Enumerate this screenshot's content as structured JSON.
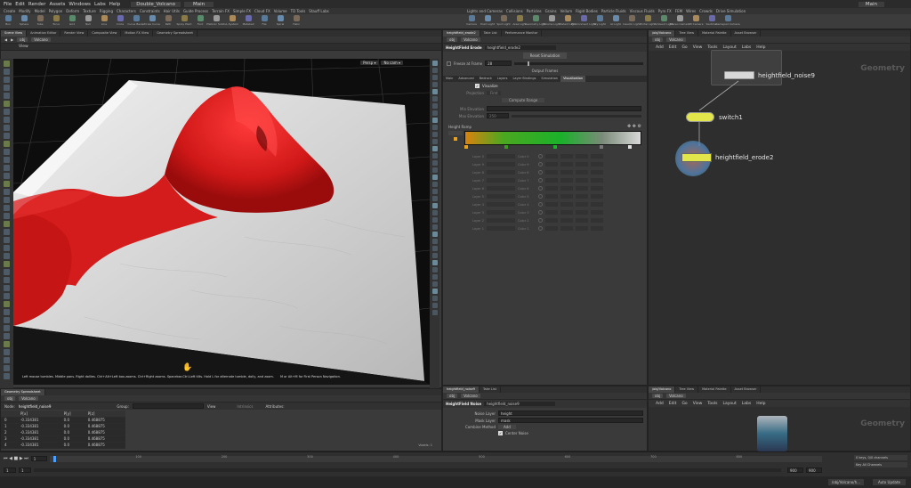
{
  "app": {
    "menu": [
      "File",
      "Edit",
      "Render",
      "Assets",
      "Windows",
      "Labs",
      "Help"
    ],
    "scene_file": "Double_Volcano",
    "desktop": "Main",
    "right_desktop": "Main"
  },
  "shelf_tabs": [
    "Create",
    "Modify",
    "Model",
    "Polygon",
    "Deform",
    "Texture",
    "Rigging",
    "Characters",
    "Constraints",
    "Hair Utils",
    "Guide Process",
    "Terrain FX",
    "Simple FX",
    "Cloud FX",
    "Volume",
    "TD Tools",
    "Stauff Labs"
  ],
  "shelf_tools": [
    "Box",
    "Sphere",
    "Tube",
    "Torus",
    "Grid",
    "Null",
    "Line",
    "Circle",
    "Curve Bezier",
    "Draw Curve",
    "Path",
    "Spray Paint",
    "Font",
    "Platonic Solids",
    "L-System",
    "Metaball",
    "File",
    "Spiral",
    "Helix"
  ],
  "light_tabs": [
    "Lights and Cameras",
    "Collisions",
    "Particles",
    "Grains",
    "Vellum",
    "Rigid Bodies",
    "Particle Fluids",
    "Viscous Fluids",
    "Pyro FX",
    "FEM",
    "Wires",
    "Crowds",
    "Drive Simulation"
  ],
  "light_tools": [
    "Camera",
    "Point Light",
    "Spot Light",
    "Area Light",
    "Geometry Light",
    "Volume Light",
    "Distant Light",
    "Environment Light",
    "Sky Light",
    "GI Light",
    "Caustic Light",
    "Portal Light",
    "Ambient Light",
    "Stereo Camera",
    "VR Camera",
    "Switcher",
    "Gamepad Camera"
  ],
  "viewport": {
    "tabs": [
      "Scene View",
      "Animation Editor",
      "Render View",
      "Composite View",
      "Motion FX View",
      "Geometry Spreadsheet"
    ],
    "path": [
      "obj",
      "Volcano"
    ],
    "label": "View",
    "persp": "Persp ▾",
    "cam": "No cam ▾",
    "hint": "Left mouse tumbles. Middle pans. Right dollies. Ctrl+Alt+Left box-zooms. Ctrl+Right zooms. Spacebar-Ctrl-Left tilts. Hold L for alternate tumble, dolly, and zoom.",
    "hint2": "M or Alt+M for First Person Navigation."
  },
  "spreadsheet": {
    "tabs": [
      "Geometry Spreadsheet"
    ],
    "path": [
      "obj",
      "Volcano"
    ],
    "node": "heightfield_noise9",
    "group_label": "Group:",
    "view_label": "View",
    "intrinsics": "Intrinsics",
    "attributes": "Attributes:",
    "headers": [
      "",
      "P[x]",
      "P[y]",
      "P[z]"
    ],
    "rows": [
      [
        "0",
        "-0.334381",
        "0.0",
        "0.468875"
      ],
      [
        "1",
        "-0.334381",
        "0.0",
        "0.468875"
      ],
      [
        "2",
        "-0.334381",
        "0.0",
        "0.468875"
      ],
      [
        "3",
        "-0.334381",
        "0.0",
        "0.468875"
      ],
      [
        "4",
        "-0.334381",
        "0.0",
        "0.468875"
      ]
    ],
    "footer": "Voxels: 1"
  },
  "params_top": {
    "tabs": [
      "heightfield_erode2",
      "Take List",
      "Performance Monitor"
    ],
    "path": [
      "obj",
      "Volcano"
    ],
    "node_type": "HeightField Erode",
    "node_name": "heightfield_erode2",
    "reset_sim": "Reset Simulation",
    "freeze_label": "Freeze at Frame",
    "freeze_value": "28",
    "output_frames": "Output Frames",
    "subtabs": [
      "Main",
      "Advanced",
      "Bedrock",
      "Layers",
      "Layer Bindings",
      "Simulation",
      "Visualization"
    ],
    "active_subtab": "Visualization",
    "visualize": "Visualize",
    "projection_label": "Projection",
    "projection_value": "First",
    "compute_range": "Compute Range",
    "min_elev_label": "Min Elevation",
    "max_elev_label": "Max Elevation",
    "max_elev_value": "250",
    "ramp_label": "Height Ramp",
    "layers": [
      {
        "label": "Layer 0",
        "color": "Color 0"
      },
      {
        "label": "Layer 9",
        "color": "Color 9"
      },
      {
        "label": "Layer 8",
        "color": "Color 8"
      },
      {
        "label": "Layer 7",
        "color": "Color 7"
      },
      {
        "label": "Layer 6",
        "color": "Color 6"
      },
      {
        "label": "Layer 5",
        "color": "Color 5"
      },
      {
        "label": "Layer 4",
        "color": "Color 4"
      },
      {
        "label": "Layer 3",
        "color": "Color 3"
      },
      {
        "label": "Layer 2",
        "color": "Color 2"
      },
      {
        "label": "Layer 1",
        "color": "Color 1"
      }
    ]
  },
  "params_bottom": {
    "tabs": [
      "heightfield_noise9",
      "Take List"
    ],
    "path": [
      "obj",
      "Volcano"
    ],
    "node_type": "HeightField Noise",
    "node_name": "heightfield_noise9",
    "noise_layer_label": "Noise Layer",
    "noise_layer_value": "height",
    "mask_layer_label": "Mask Layer",
    "mask_layer_value": "mask",
    "combine_label": "Combine Method",
    "combine_value": "Add",
    "center_noise": "Center Noise"
  },
  "network_top": {
    "tabs": [
      "/obj/Volcano",
      "Tree View",
      "Material Palette",
      "Asset Browser"
    ],
    "menu": [
      "Add",
      "Edit",
      "Go",
      "View",
      "Tools",
      "Layout",
      "Labs",
      "Help"
    ],
    "path": [
      "obj",
      "Volcano"
    ],
    "context": "Geometry",
    "nodes": [
      "heightfield_noise9",
      "switch1",
      "heightfield_erode2"
    ]
  },
  "network_bottom": {
    "tabs": [
      "/obj/Volcano",
      "Tree View",
      "Material Palette",
      "Asset Browser"
    ],
    "menu": [
      "Add",
      "Edit",
      "Go",
      "View",
      "Tools",
      "Layout",
      "Labs",
      "Help"
    ],
    "path": [
      "obj",
      "Volcano"
    ],
    "context": "Geometry"
  },
  "timeline": {
    "frame": "1",
    "start": "1",
    "end": "1",
    "end2": "900",
    "end3": "900",
    "ticks": [
      "100",
      "200",
      "300",
      "400",
      "500",
      "600",
      "700",
      "800"
    ],
    "keys_label": "0 keys, 0/0 channels",
    "key_all": "Key All Channels",
    "auto_update": "Auto Update",
    "status_path": "/obj/Volcano/h..."
  },
  "colors": {
    "accent": "#e8a020",
    "lava": "#d92020",
    "terrain": "#d4d4d4",
    "node_yellow": "#e3e64a"
  }
}
